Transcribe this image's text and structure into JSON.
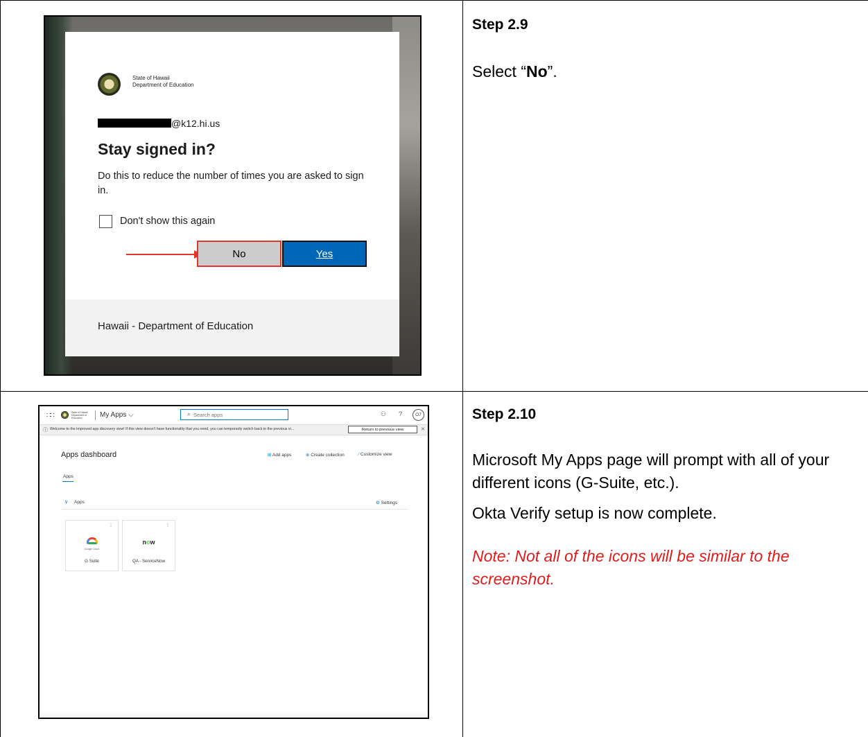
{
  "steps": [
    {
      "title": "Step 2.9",
      "text_before": "Select “",
      "text_bold": "No",
      "text_after": "”."
    },
    {
      "title": "Step 2.10",
      "para1": "Microsoft My Apps page will prompt with all of your different icons (G-Suite, etc.).",
      "para2": "Okta Verify setup is now complete.",
      "note": "Note: Not all of the icons will be similar to the screenshot."
    }
  ],
  "signin": {
    "org_line1": "State of Hawaii",
    "org_line2": "Department of Education",
    "email_suffix": "@k12.hi.us",
    "title": "Stay signed in?",
    "description": "Do this to reduce the number of times you are asked to sign in.",
    "checkbox_label": "Don't show this again",
    "no_label": "No",
    "yes_label": "Yes",
    "footer": "Hawaii - Department of Education",
    "colors": {
      "accent": "#0067b8",
      "highlight": "#e0352b"
    }
  },
  "myapps": {
    "app_name": "My Apps",
    "search_placeholder": "Search apps",
    "avatar_initials": "O7",
    "banner_text": "Welcome to the improved app discovery view! If this view doesn't have functionality that you need, you can temporarily switch back to the previous vi...",
    "return_label": "Return to previous view",
    "dashboard_title": "Apps dashboard",
    "add_apps": "Add apps",
    "create_collection": "Create collection",
    "customize_view": "Customize view",
    "tab_apps": "Apps",
    "section_label": "Apps",
    "settings": "Settings",
    "tiles": [
      {
        "name": "G Suite",
        "logo_caption": "Google Cloud",
        "icon": "google-cloud-icon"
      },
      {
        "name": "QA - ServiceNow",
        "logo_text_a": "n",
        "logo_text_o": "o",
        "logo_text_b": "w",
        "icon": "servicenow-icon"
      }
    ]
  }
}
